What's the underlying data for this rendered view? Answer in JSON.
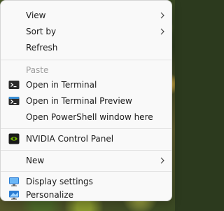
{
  "menu": {
    "view": "View",
    "sort_by": "Sort by",
    "refresh": "Refresh",
    "paste": "Paste",
    "open_terminal": "Open in Terminal",
    "open_terminal_preview": "Open in Terminal Preview",
    "open_powershell": "Open PowerShell window here",
    "nvidia": "NVIDIA Control Panel",
    "new": "New",
    "display_settings": "Display settings",
    "personalize": "Personalize"
  },
  "icons": {
    "terminal": "terminal-icon",
    "terminal_preview": "terminal-preview-icon",
    "nvidia": "nvidia-icon",
    "display": "display-icon",
    "personalize": "personalize-icon"
  },
  "colors": {
    "nvidia_green": "#76b900",
    "display_blue": "#2b7cd3"
  }
}
